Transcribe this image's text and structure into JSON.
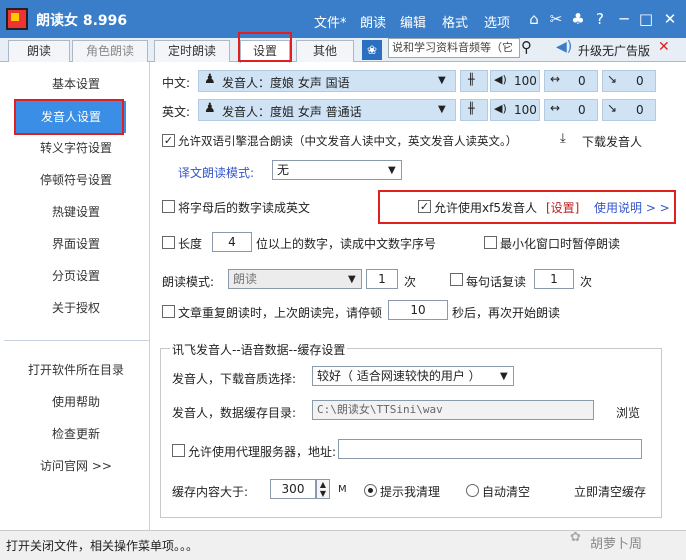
{
  "app": {
    "title": "朗读女 8.996"
  },
  "menu": [
    "文件*",
    "朗读",
    "编辑",
    "格式",
    "选项"
  ],
  "tabs": [
    "朗读",
    "角色朗读",
    "定时朗读",
    "设置",
    "其他"
  ],
  "search": {
    "value": "说和学习资料音频等（它"
  },
  "upgrade": "升级无广告版",
  "sidebar": {
    "items": [
      "基本设置",
      "发音人设置",
      "转义字符设置",
      "停顿符号设置",
      "热键设置",
      "界面设置",
      "分页设置",
      "关于授权"
    ],
    "links": [
      "打开软件所在目录",
      "使用帮助",
      "检查更新",
      "访问官网 >>"
    ]
  },
  "voice": {
    "zh_label": "中文:",
    "zh_voice": "发音人：度娘 女声 国语",
    "en_label": "英文:",
    "en_voice": "发音人：度姐 女声 普通话",
    "volume": "100",
    "speed": "0",
    "pitch": "0",
    "mix_allow": "允许双语引擎混合朗读（中文发音人读中文，英文发音人读英文。）",
    "download": "下载发音人",
    "translate_mode_label": "译文朗读模式:",
    "translate_mode_value": "无"
  },
  "options": {
    "letters_digits": "将字母后的数字读成英文",
    "xf_allow": "允许使用xf5发音人",
    "xf_settings": "[设置]",
    "xf_help": "使用说明 > >",
    "length_label": "长度",
    "length_value": "4",
    "length_suffix": "位以上的数字，读成中文数字序号",
    "minimize_pause": "最小化窗口时暂停朗读",
    "read_mode_label": "朗读模式:",
    "read_mode_value": "朗读",
    "read_times": "1",
    "times_unit": "次",
    "repeat_each": "每句话复读",
    "repeat_times": "1",
    "repeat_unit": "次",
    "repeat_article": "文章重复朗读时，上次朗读完，请停顿",
    "pause_seconds": "10",
    "pause_suffix": "秒后，再次开始朗读"
  },
  "cache": {
    "title": "讯飞发音人--语音数据--缓存设置",
    "quality_label": "发音人，下载音质选择:",
    "quality_value": "较好（ 适合网速较快的用户 ）",
    "dir_label": "发音人，数据缓存目录:",
    "dir_value": "C:\\朗读女\\TTSini\\wav",
    "browse": "浏览",
    "proxy_label": "允许使用代理服务器，地址:",
    "size_label": "缓存内容大于:",
    "size_value": "300",
    "size_unit": "M",
    "prompt_clean": "提示我清理",
    "auto_clean": "自动清空",
    "clear_now": "立即清空缓存"
  },
  "status": {
    "text": "打开关闭文件，相关操作菜单项。。。",
    "watermark": "胡萝卜周"
  },
  "colors": {
    "title_bar": "#3a7ec9",
    "selection": "#3a8ee6",
    "highlight_box": "#e02020",
    "link_blue": "#3355cc"
  }
}
